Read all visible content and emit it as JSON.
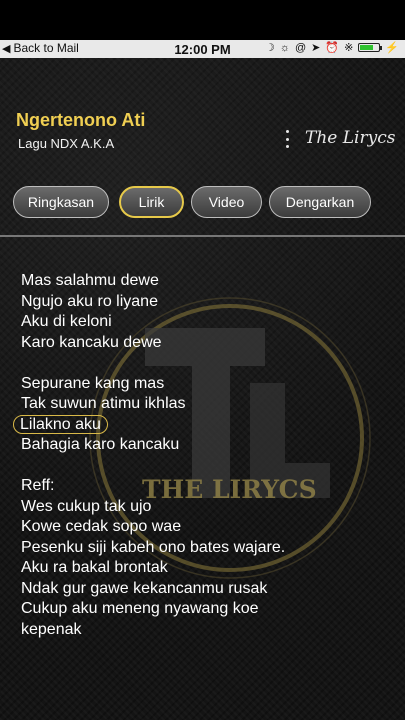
{
  "status_bar": {
    "back_label": "Back to Mail",
    "time": "12:00 PM",
    "icons": [
      "moon-icon",
      "brightness-icon",
      "at-icon",
      "location-icon",
      "alarm-icon",
      "bluetooth-icon",
      "battery-icon",
      "charging-icon"
    ],
    "battery_fraction": 0.7,
    "battery_color": "#2ec22e"
  },
  "header": {
    "title": "Ngertenono Ati",
    "subtitle": "Lagu NDX A.K.A",
    "brand": "The Lirycs",
    "title_color": "#f0cf52"
  },
  "tabs": [
    {
      "label": "Ringkasan",
      "active": false
    },
    {
      "label": "Lirik",
      "active": true
    },
    {
      "label": "Video",
      "active": false
    },
    {
      "label": "Dengarkan",
      "active": false
    }
  ],
  "watermark_text": "THE LIRYCS",
  "lyrics": [
    "Mas salahmu dewe",
    "Ngujo aku ro liyane",
    "Aku di keloni",
    "Karo kancaku dewe",
    "",
    "Sepurane kang mas",
    "Tak suwun atimu ikhlas",
    "Lilakno aku",
    "Bahagia karo kancaku",
    "",
    "Reff:",
    "Wes cukup tak ujo",
    "Kowe cedak sopo wae",
    "Pesenku siji kabeh ono bates wajare.",
    "Aku ra bakal brontak",
    "Ndak gur gawe kekancanmu rusak",
    "Cukup aku meneng nyawang koe",
    "kepenak"
  ],
  "highlighted_line_index": 7,
  "accent_color": "#e6c94a"
}
